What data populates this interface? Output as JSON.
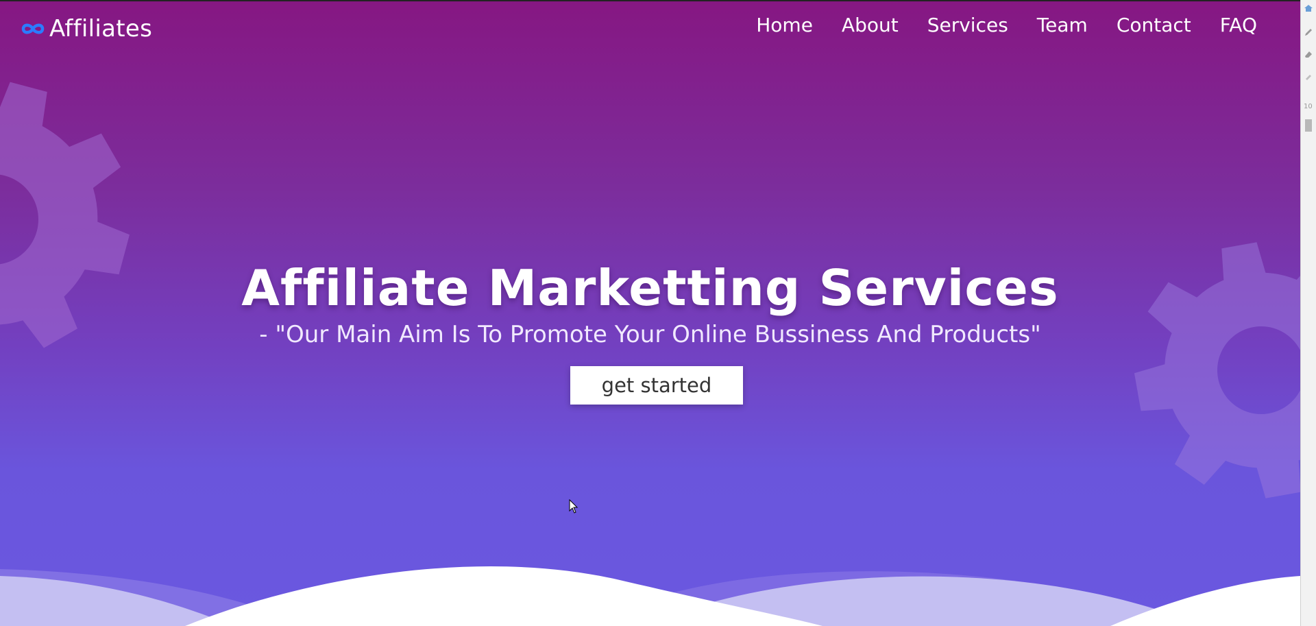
{
  "brand": {
    "name": "Affiliates",
    "icon": "infinity-icon",
    "icon_color": "#2b7cff"
  },
  "nav": {
    "items": [
      {
        "label": "Home"
      },
      {
        "label": "About"
      },
      {
        "label": "Services"
      },
      {
        "label": "Team"
      },
      {
        "label": "Contact"
      },
      {
        "label": "FAQ"
      }
    ]
  },
  "hero": {
    "title": "Affiliate Marketting Services",
    "subtitle": "- \"Our Main Aim Is To Promote Your Online Bussiness And Products\"",
    "cta_label": "get started",
    "gradient_top": "#861782",
    "gradient_bottom": "#6a58e0"
  },
  "sidebar": {
    "number_label": "10"
  }
}
